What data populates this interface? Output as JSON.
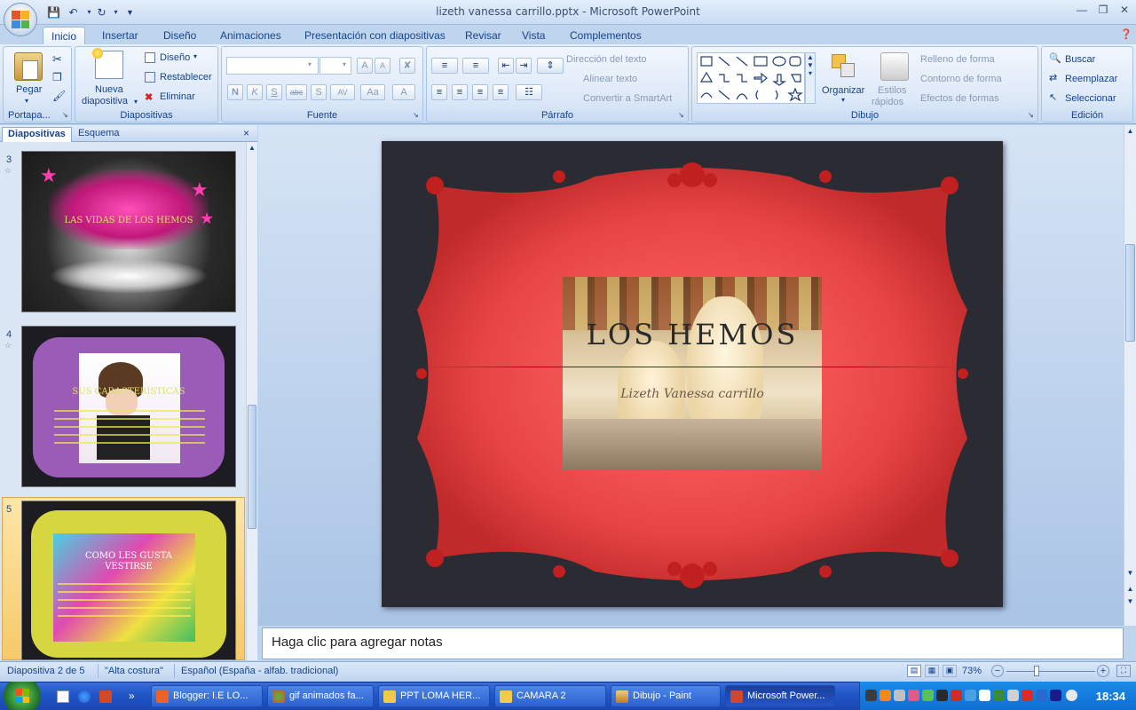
{
  "window": {
    "title": "lizeth vanessa carrillo.pptx - Microsoft PowerPoint"
  },
  "tabs": [
    "Inicio",
    "Insertar",
    "Diseño",
    "Animaciones",
    "Presentación con diapositivas",
    "Revisar",
    "Vista",
    "Complementos"
  ],
  "active_tab": "Inicio",
  "ribbon": {
    "portapapeles": {
      "label": "Portapa...",
      "paste": "Pegar"
    },
    "diapositivas": {
      "label": "Diapositivas",
      "new_slide_1": "Nueva",
      "new_slide_2": "diapositiva",
      "layout": "Diseño",
      "reset": "Restablecer",
      "delete": "Eliminar"
    },
    "fuente": {
      "label": "Fuente"
    },
    "parrafo": {
      "label": "Párrafo",
      "text_direction": "Dirección del texto",
      "align_text": "Alinear texto",
      "smartart": "Convertir a SmartArt"
    },
    "dibujo": {
      "label": "Dibujo",
      "arrange": "Organizar",
      "quick_styles_1": "Estilos",
      "quick_styles_2": "rápidos",
      "shape_fill": "Relleno de forma",
      "shape_outline": "Contorno de forma",
      "shape_effects": "Efectos de formas"
    },
    "edicion": {
      "label": "Edición",
      "find": "Buscar",
      "replace": "Reemplazar",
      "select": "Seleccionar"
    }
  },
  "left_pane": {
    "tabs": [
      "Diapositivas",
      "Esquema"
    ],
    "thumbnails": [
      {
        "num": "3",
        "title": "LAS VIDAS DE LOS HEMOS"
      },
      {
        "num": "4",
        "title": "SUS CARACTERISTICAS"
      },
      {
        "num": "5",
        "title": "COMO LES GUSTA VESTIRSE"
      }
    ]
  },
  "slide": {
    "title": "LOS HEMOS",
    "subtitle": "Lizeth Vanessa carrillo"
  },
  "notes": {
    "placeholder": "Haga clic para agregar notas"
  },
  "status": {
    "slide_info": "Diapositiva 2 de 5",
    "theme": "\"Alta costura\"",
    "language": "Español (España - alfab. tradicional)",
    "zoom": "73%"
  },
  "taskbar": {
    "tasks": [
      "Blogger: I.E LO...",
      "gif animados fa...",
      "PPT LOMA HER...",
      "CAMARA 2",
      "Dibujo - Paint",
      "Microsoft Power..."
    ],
    "clock": "18:34"
  }
}
